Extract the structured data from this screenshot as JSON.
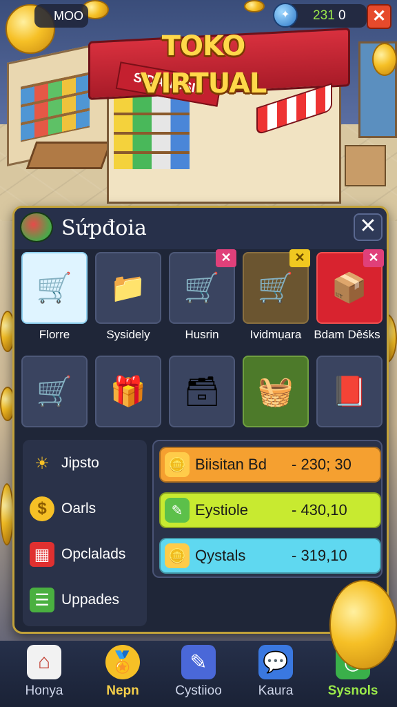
{
  "title": "TOKO VIRTUAL",
  "store_sign": "SIDANCSIA",
  "hud": {
    "left_text": "MOO",
    "right_text_a": "231",
    "right_text_b": "0",
    "close_label": "✕",
    "gem_symbol": "✦"
  },
  "panel": {
    "title": "Sứpđoia",
    "close_label": "✕",
    "tiles_row1": [
      {
        "label": "Florre",
        "icon": "🛒",
        "badge": ""
      },
      {
        "label": "Sysidely",
        "icon": "📁",
        "badge": ""
      },
      {
        "label": "Husrin",
        "icon": "🛒",
        "badge": "✕"
      },
      {
        "label": "Ividmụara",
        "icon": "🛒",
        "badge": "✕"
      },
      {
        "label": "Bdam Dêśks",
        "icon": "📦",
        "badge": "✕"
      }
    ],
    "tiles_row2": [
      {
        "icon": "🛒"
      },
      {
        "icon": "🎁"
      },
      {
        "icon": "🗃"
      },
      {
        "icon": "🧺"
      },
      {
        "icon": "📕"
      }
    ],
    "side_items": [
      {
        "label": "Jipsto",
        "icon": "☀"
      },
      {
        "label": "Oarls",
        "icon": "$"
      },
      {
        "label": "Opclalads",
        "icon": "▦"
      },
      {
        "label": "Uppades",
        "icon": "☰"
      }
    ],
    "resources": [
      {
        "name": "Biisitan Bd",
        "value": "-   230; 30",
        "icon": "🪙",
        "color": "#f5a030"
      },
      {
        "name": "Eystiole",
        "value": "-   430,10",
        "icon": "✎",
        "color": "#c8ea30"
      },
      {
        "name": "Qystals",
        "value": "-   319,10",
        "icon": "🪙",
        "color": "#5fd8f0"
      }
    ]
  },
  "nav": [
    {
      "label": "Honya",
      "icon": "⌂",
      "state": "normal"
    },
    {
      "label": "Nepn",
      "icon": "🏅",
      "state": "active"
    },
    {
      "label": "Cystiioo",
      "icon": "✎",
      "state": "normal"
    },
    {
      "label": "Kaura",
      "icon": "💬",
      "state": "normal"
    },
    {
      "label": "Sysnols",
      "icon": "◎",
      "state": "green"
    }
  ],
  "colors": {
    "accent_gold": "#c2a23a",
    "panel_bg": "#1f2638",
    "danger": "#e64a2c"
  }
}
